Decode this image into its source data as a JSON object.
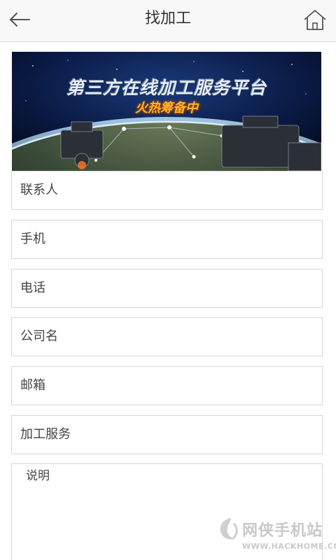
{
  "header": {
    "title": "找加工",
    "back_icon": "arrow-left-icon",
    "home_icon": "home-icon"
  },
  "banner": {
    "title": "第三方在线加工服务平台",
    "subtitle": "火热筹备中"
  },
  "form": {
    "fields": [
      {
        "placeholder": "联系人"
      },
      {
        "placeholder": "手机"
      },
      {
        "placeholder": "电话"
      },
      {
        "placeholder": "公司名"
      },
      {
        "placeholder": "邮箱"
      },
      {
        "placeholder": "加工服务"
      }
    ],
    "description_placeholder": "说明"
  },
  "watermark": {
    "name": "网侠手机站",
    "url": "WWW.HACKHOME.COM"
  },
  "colors": {
    "header_bg": "#f8f8f8",
    "border": "#d6d6d6",
    "text": "#444444",
    "banner_highlight": "#ffb52a"
  }
}
